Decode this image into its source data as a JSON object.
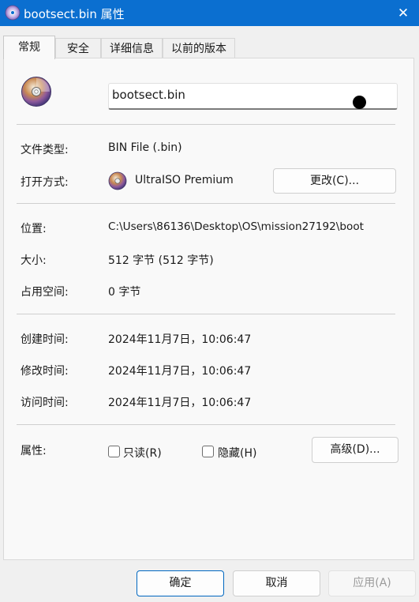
{
  "window": {
    "title": "bootsect.bin 属性",
    "close_glyph": "✕"
  },
  "tabs": [
    {
      "label": "常规",
      "active": true
    },
    {
      "label": "安全",
      "active": false
    },
    {
      "label": "详细信息",
      "active": false
    },
    {
      "label": "以前的版本",
      "active": false
    }
  ],
  "general": {
    "file_name": "bootsect.bin",
    "file_type_label": "文件类型:",
    "file_type_value": "BIN File (.bin)",
    "open_with_label": "打开方式:",
    "open_with_value": "UltraISO Premium",
    "change_button": "更改(C)...",
    "location_label": "位置:",
    "location_value": "C:\\Users\\86136\\Desktop\\OS\\mission27192\\boot",
    "size_label": "大小:",
    "size_value": "512 字节 (512 字节)",
    "size_on_disk_label": "占用空间:",
    "size_on_disk_value": "0 字节",
    "created_label": "创建时间:",
    "created_value": "2024年11月7日，10:06:47",
    "modified_label": "修改时间:",
    "modified_value": "2024年11月7日，10:06:47",
    "accessed_label": "访问时间:",
    "accessed_value": "2024年11月7日，10:06:47",
    "attributes_label": "属性:",
    "readonly_label": "只读(R)",
    "hidden_label": "隐藏(H)",
    "readonly_checked": false,
    "hidden_checked": false,
    "advanced_button": "高级(D)..."
  },
  "footer": {
    "ok_button": "确定",
    "cancel_button": "取消",
    "apply_button": "应用(A)"
  },
  "colors": {
    "titlebar": "#0b6fd0",
    "accent": "#0067c0"
  },
  "icons": [
    "disc-icon",
    "ultraiso-icon",
    "close-icon"
  ]
}
